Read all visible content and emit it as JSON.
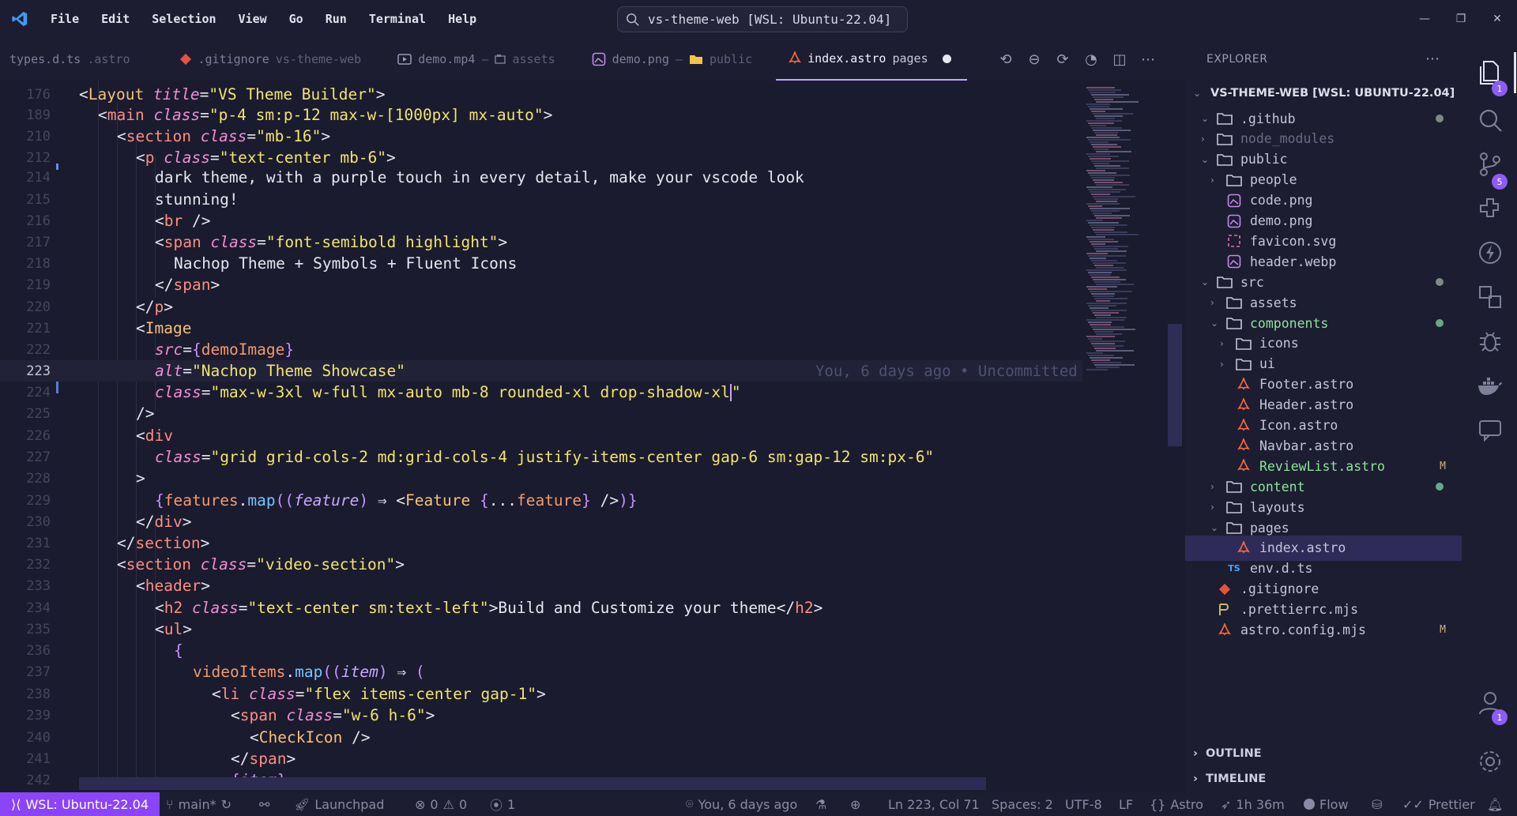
{
  "titlebar": {
    "menu": [
      "File",
      "Edit",
      "Selection",
      "View",
      "Go",
      "Run",
      "Terminal",
      "Help"
    ],
    "command_center": "vs-theme-web [WSL: Ubuntu-22.04]"
  },
  "tabs": [
    {
      "name": "types.d.ts",
      "desc": ".astro",
      "icon": "typescript-icon"
    },
    {
      "name": ".gitignore",
      "desc": "vs-theme-web",
      "icon": "git-icon"
    },
    {
      "name": "demo.mp4",
      "desc": "assets",
      "sep": "–",
      "icon": "video-icon"
    },
    {
      "name": "demo.png",
      "desc": "public",
      "sep": "–",
      "icon": "image-icon"
    },
    {
      "name": "index.astro",
      "desc": "pages",
      "icon": "astro-icon",
      "active": true
    }
  ],
  "editor": {
    "current_line": "223",
    "blame": "You, 6 days ago • Uncommitted",
    "line_numbers": [
      "176",
      "189",
      "210",
      "212",
      "214",
      "215",
      "216",
      "217",
      "218",
      "219",
      "220",
      "221",
      "222",
      "223",
      "224",
      "225",
      "226",
      "227",
      "228",
      "229",
      "230",
      "231",
      "232",
      "233",
      "234",
      "235",
      "236",
      "237",
      "238",
      "239",
      "240",
      "241",
      "242"
    ]
  },
  "explorer": {
    "title": "EXPLORER",
    "root": "VS-THEME-WEB [WSL: UBUNTU-22.04]",
    "items": [
      {
        "label": ".github",
        "level": 1,
        "type": "folder",
        "open": true,
        "dot": true
      },
      {
        "label": "node_modules",
        "level": 1,
        "type": "folder",
        "dim": true
      },
      {
        "label": "public",
        "level": 1,
        "type": "folder",
        "open": true
      },
      {
        "label": "people",
        "level": 2,
        "type": "folder"
      },
      {
        "label": "code.png",
        "level": 2,
        "type": "image"
      },
      {
        "label": "demo.png",
        "level": 2,
        "type": "image"
      },
      {
        "label": "favicon.svg",
        "level": 2,
        "type": "svg"
      },
      {
        "label": "header.webp",
        "level": 2,
        "type": "image"
      },
      {
        "label": "src",
        "level": 1,
        "type": "folder",
        "open": true,
        "dot": true
      },
      {
        "label": "assets",
        "level": 2,
        "type": "folder"
      },
      {
        "label": "components",
        "level": 2,
        "type": "folder",
        "open": true,
        "green": true,
        "dot": true
      },
      {
        "label": "icons",
        "level": 3,
        "type": "folder"
      },
      {
        "label": "ui",
        "level": 3,
        "type": "folder"
      },
      {
        "label": "Footer.astro",
        "level": 3,
        "type": "astro"
      },
      {
        "label": "Header.astro",
        "level": 3,
        "type": "astro"
      },
      {
        "label": "Icon.astro",
        "level": 3,
        "type": "astro"
      },
      {
        "label": "Navbar.astro",
        "level": 3,
        "type": "astro"
      },
      {
        "label": "ReviewList.astro",
        "level": 3,
        "type": "astro",
        "modified": "M",
        "green": true
      },
      {
        "label": "content",
        "level": 2,
        "type": "folder",
        "green": true,
        "dot": true
      },
      {
        "label": "layouts",
        "level": 2,
        "type": "folder"
      },
      {
        "label": "pages",
        "level": 2,
        "type": "folder",
        "open": true
      },
      {
        "label": "index.astro",
        "level": 3,
        "type": "astro",
        "selected": true
      },
      {
        "label": "env.d.ts",
        "level": 2,
        "type": "ts"
      },
      {
        "label": ".gitignore",
        "level": 1,
        "type": "git"
      },
      {
        "label": ".prettierrc.mjs",
        "level": 1,
        "type": "prettier"
      },
      {
        "label": "astro.config.mjs",
        "level": 1,
        "type": "astro",
        "modified": "M"
      }
    ],
    "outline": "OUTLINE",
    "timeline": "TIMELINE"
  },
  "activity_badges": {
    "explorer": "1",
    "scm": "5",
    "accounts": "1"
  },
  "statusbar": {
    "remote": "WSL: Ubuntu-22.04",
    "branch": "main*",
    "launchpad": "Launchpad",
    "errors": "0",
    "warnings": "0",
    "ports": "1",
    "blame": "You, 6 days ago",
    "position": "Ln 223, Col 71",
    "spaces": "Spaces: 2",
    "encoding": "UTF-8",
    "eol": "LF",
    "language": "Astro",
    "time": "1h 36m",
    "flow": "Flow",
    "prettier": "Prettier"
  },
  "colors": {
    "accent": "#8b44f7",
    "background": "#1a1b2e",
    "sidebar": "#1c1d31"
  }
}
